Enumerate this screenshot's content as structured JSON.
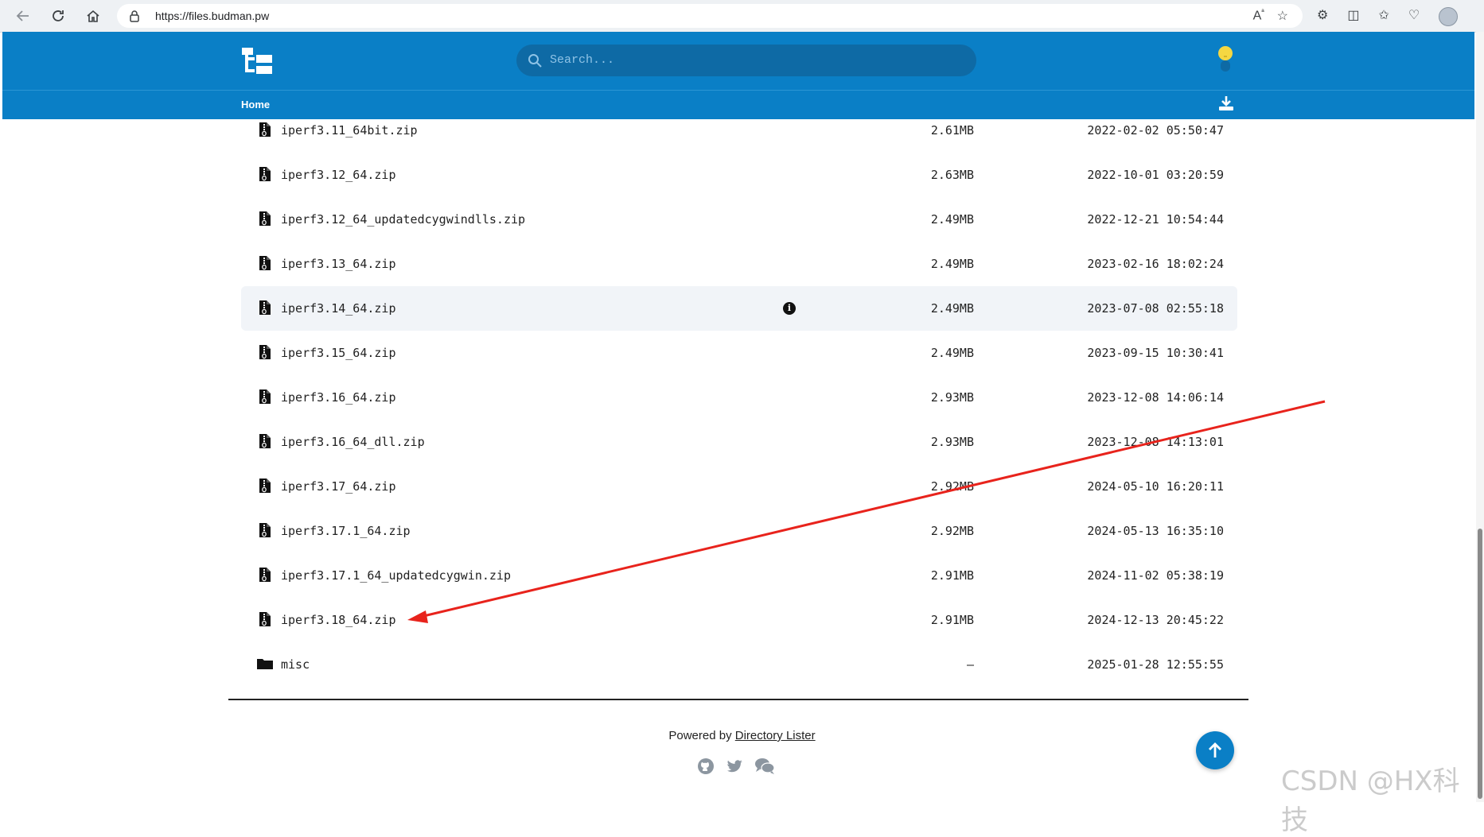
{
  "browser": {
    "url": "https://files.budman.pw"
  },
  "header": {
    "search_placeholder": "Search...",
    "breadcrumb_home": "Home"
  },
  "files": [
    {
      "name": "iperf3.11_64bit.zip",
      "size": "2.61MB",
      "date": "2022-02-02 05:50:47",
      "type": "file"
    },
    {
      "name": "iperf3.12_64.zip",
      "size": "2.63MB",
      "date": "2022-10-01 03:20:59",
      "type": "file"
    },
    {
      "name": "iperf3.12_64_updatedcygwindlls.zip",
      "size": "2.49MB",
      "date": "2022-12-21 10:54:44",
      "type": "file"
    },
    {
      "name": "iperf3.13_64.zip",
      "size": "2.49MB",
      "date": "2023-02-16 18:02:24",
      "type": "file"
    },
    {
      "name": "iperf3.14_64.zip",
      "size": "2.49MB",
      "date": "2023-07-08 02:55:18",
      "type": "file",
      "hovered": true
    },
    {
      "name": "iperf3.15_64.zip",
      "size": "2.49MB",
      "date": "2023-09-15 10:30:41",
      "type": "file"
    },
    {
      "name": "iperf3.16_64.zip",
      "size": "2.93MB",
      "date": "2023-12-08 14:06:14",
      "type": "file"
    },
    {
      "name": "iperf3.16_64_dll.zip",
      "size": "2.93MB",
      "date": "2023-12-08 14:13:01",
      "type": "file"
    },
    {
      "name": "iperf3.17_64.zip",
      "size": "2.92MB",
      "date": "2024-05-10 16:20:11",
      "type": "file"
    },
    {
      "name": "iperf3.17.1_64.zip",
      "size": "2.92MB",
      "date": "2024-05-13 16:35:10",
      "type": "file"
    },
    {
      "name": "iperf3.17.1_64_updatedcygwin.zip",
      "size": "2.91MB",
      "date": "2024-11-02 05:38:19",
      "type": "file"
    },
    {
      "name": "iperf3.18_64.zip",
      "size": "2.91MB",
      "date": "2024-12-13 20:45:22",
      "type": "file"
    },
    {
      "name": "misc",
      "size": "—",
      "date": "2025-01-28 12:55:55",
      "type": "folder"
    }
  ],
  "footer": {
    "powered_prefix": "Powered by",
    "powered_link": "Directory Lister"
  },
  "watermark": "CSDN @HX科技",
  "colors": {
    "brand": "#0a7fc6",
    "annotation_arrow": "#e8231c"
  }
}
